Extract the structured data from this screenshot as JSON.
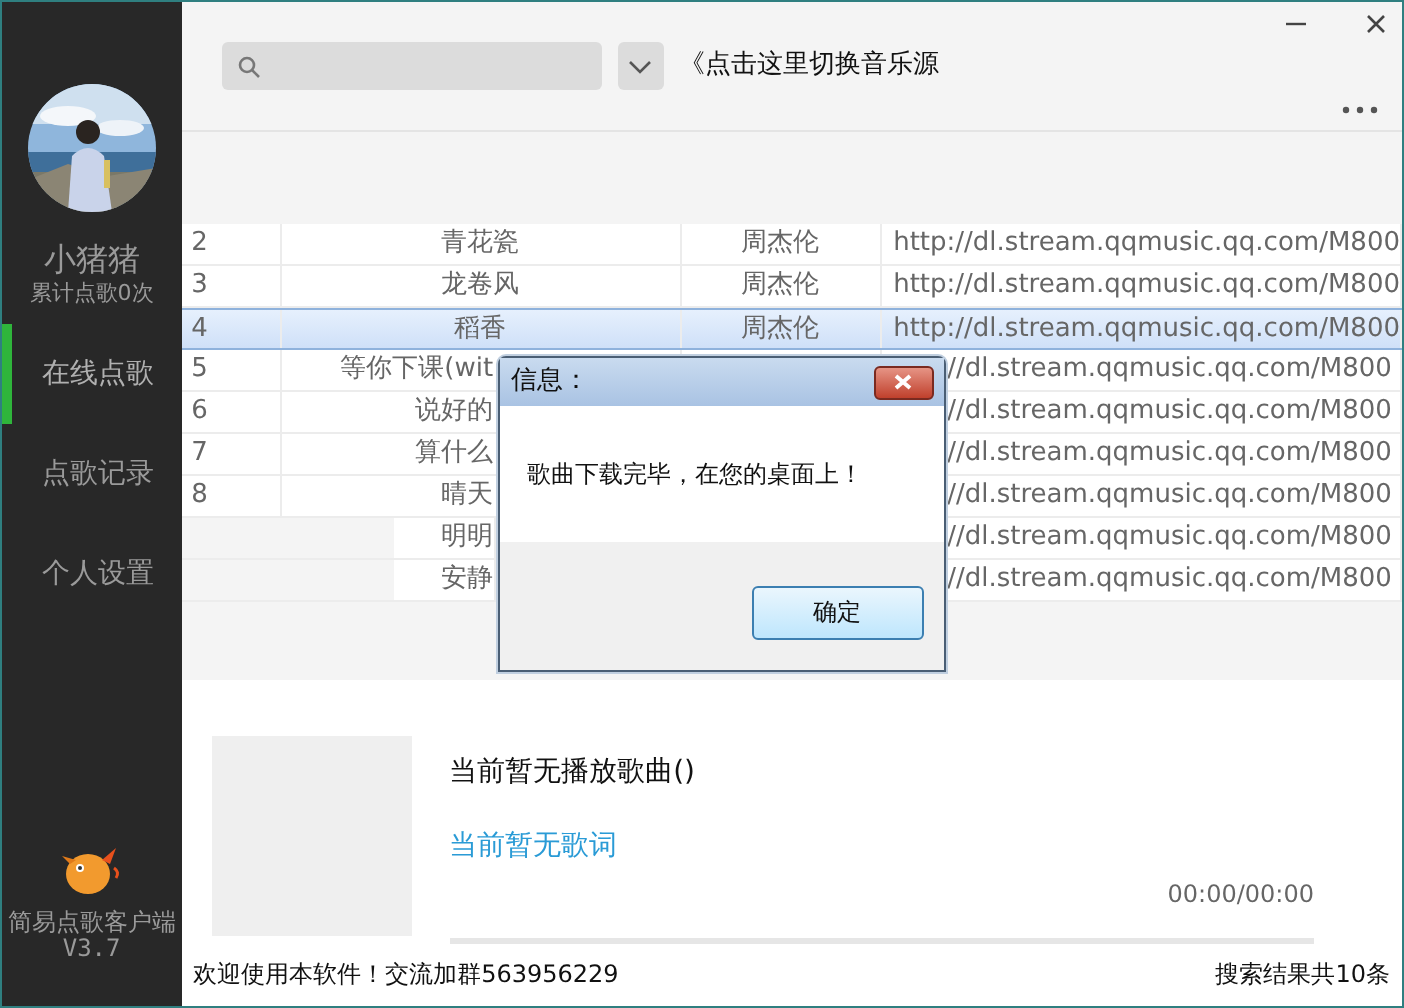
{
  "user": {
    "name": "小猪猪",
    "stat": "累计点歌0次"
  },
  "nav": [
    {
      "label": "在线点歌",
      "selected": true
    },
    {
      "label": "点歌记录",
      "selected": false
    },
    {
      "label": "个人设置",
      "selected": false
    }
  ],
  "app": {
    "name": "简易点歌客户端",
    "version": "V3.7"
  },
  "source_switch": {
    "label": "《点击这里切换音乐源"
  },
  "table": {
    "rows": [
      {
        "kind": "full",
        "index": "2",
        "title": "青花瓷",
        "singer": "周杰伦",
        "url": "http://dl.stream.qqmusic.qq.com/M800",
        "selected": false
      },
      {
        "kind": "full",
        "index": "3",
        "title": "龙卷风",
        "singer": "周杰伦",
        "url": "http://dl.stream.qqmusic.qq.com/M800",
        "selected": false
      },
      {
        "kind": "full",
        "index": "4",
        "title": "稻香",
        "singer": "周杰伦",
        "url": "http://dl.stream.qqmusic.qq.com/M800",
        "selected": true
      },
      {
        "kind": "covered",
        "index": "5",
        "title": "等你下课(wit",
        "url": "//dl.stream.qqmusic.qq.com/M800",
        "selected": false
      },
      {
        "kind": "covered",
        "index": "6",
        "title": "说好的",
        "url": "//dl.stream.qqmusic.qq.com/M800",
        "selected": false
      },
      {
        "kind": "covered",
        "index": "7",
        "title": "算什么",
        "url": "//dl.stream.qqmusic.qq.com/M800",
        "selected": false
      },
      {
        "kind": "covered",
        "index": "8",
        "title": "晴天",
        "url": "//dl.stream.qqmusic.qq.com/M800",
        "selected": false
      },
      {
        "kind": "offset",
        "title": "明明",
        "url": "//dl.stream.qqmusic.qq.com/M800",
        "selected": false
      },
      {
        "kind": "offset",
        "title": "安静",
        "url": "//dl.stream.qqmusic.qq.com/M800",
        "selected": false
      }
    ]
  },
  "player": {
    "now_playing": "当前暂无播放歌曲()",
    "lyrics": "当前暂无歌词",
    "time": "00:00/00:00",
    "level": 0
  },
  "status_bar": {
    "left": "欢迎使用本软件！交流加群563956229",
    "right": "搜索结果共10条"
  },
  "dialog": {
    "title": "信息：",
    "message": "歌曲下载完毕，在您的桌面上！",
    "button": "确定"
  }
}
